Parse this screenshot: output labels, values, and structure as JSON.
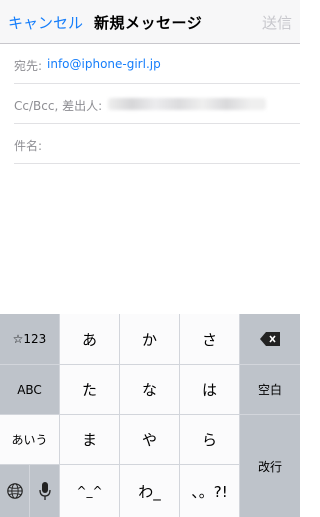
{
  "nav": {
    "cancel": "キャンセル",
    "title": "新規メッセージ",
    "send": "送信"
  },
  "fields": {
    "to_label": "宛先:",
    "to_value": "info@iphone-girl.jp",
    "cc_label": "Cc/Bcc, 差出人:",
    "subject_label": "件名:"
  },
  "keyboard": {
    "numbers": "☆123",
    "abc": "ABC",
    "aiu": "あいう",
    "row1": [
      "あ",
      "か",
      "さ"
    ],
    "row2": [
      "た",
      "な",
      "は"
    ],
    "row3": [
      "ま",
      "や",
      "ら"
    ],
    "row4": [
      "^_^",
      "わ_",
      "、。?!"
    ],
    "space": "空白",
    "return": "改行",
    "globe_icon": "globe-icon",
    "mic_icon": "microphone-icon",
    "delete_icon": "delete-backspace-icon"
  },
  "colors": {
    "accent": "#157efb",
    "disabled": "#c7c7cc"
  }
}
